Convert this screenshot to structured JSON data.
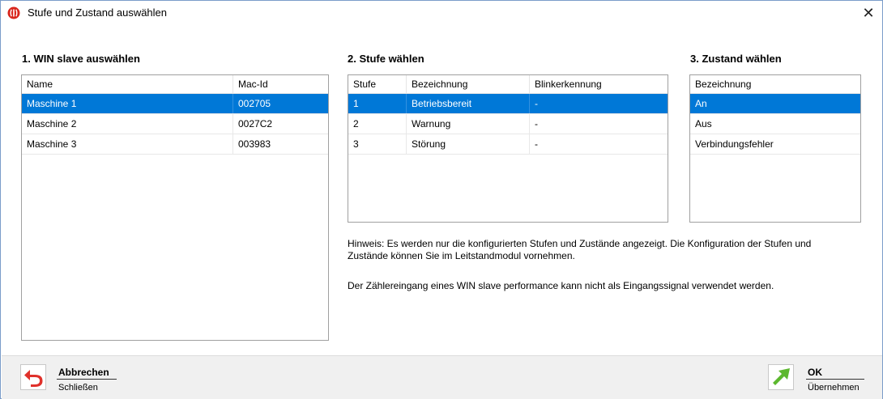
{
  "window": {
    "title": "Stufe und Zustand auswählen",
    "close_label": "✕"
  },
  "section1": {
    "title": "1. WIN slave auswählen",
    "columns": [
      "Name",
      "Mac-Id"
    ],
    "rows": [
      {
        "name": "Maschine 1",
        "mac": "002705",
        "selected": true
      },
      {
        "name": "Maschine 2",
        "mac": "0027C2",
        "selected": false
      },
      {
        "name": "Maschine 3",
        "mac": "003983",
        "selected": false
      }
    ]
  },
  "section2": {
    "title": "2. Stufe wählen",
    "columns": [
      "Stufe",
      "Bezeichnung",
      "Blinkerkennung"
    ],
    "rows": [
      {
        "stufe": "1",
        "bezeichnung": "Betriebsbereit",
        "blink": "-",
        "selected": true
      },
      {
        "stufe": "2",
        "bezeichnung": "Warnung",
        "blink": "-",
        "selected": false
      },
      {
        "stufe": "3",
        "bezeichnung": "Störung",
        "blink": "-",
        "selected": false
      }
    ]
  },
  "section3": {
    "title": "3. Zustand wählen",
    "columns": [
      "Bezeichnung"
    ],
    "rows": [
      {
        "bezeichnung": "An",
        "selected": true
      },
      {
        "bezeichnung": "Aus",
        "selected": false
      },
      {
        "bezeichnung": "Verbindungsfehler",
        "selected": false
      }
    ]
  },
  "hints": {
    "line1": "Hinweis: Es werden nur die konfigurierten Stufen und Zustände angezeigt. Die Konfiguration der Stufen und",
    "line2": "Zustände können Sie im Leitstandmodul vornehmen.",
    "line3": "Der Zählereingang eines WIN slave performance kann nicht als Eingangssignal verwendet werden."
  },
  "footer": {
    "cancel": {
      "label": "Abbrechen",
      "sub": "Schließen",
      "icon": "undo-arrow-icon"
    },
    "ok": {
      "label": "OK",
      "sub": "Übernehmen",
      "icon": "ok-arrow-icon"
    }
  },
  "colors": {
    "selection": "#0078d7",
    "cancel_icon": "#e0312b",
    "ok_icon": "#5cb82e"
  }
}
